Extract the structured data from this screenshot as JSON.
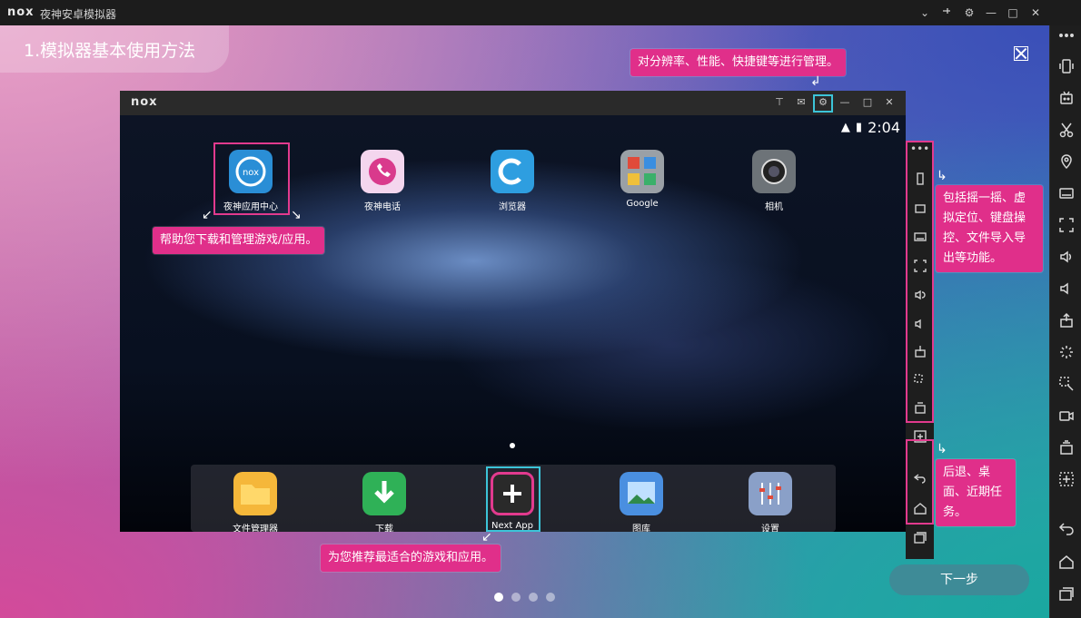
{
  "window": {
    "logo": "nox",
    "title": "夜神安卓模拟器"
  },
  "guide": {
    "heading": "1.模拟器基本使用方法",
    "callouts": {
      "settings": "对分辨率、性能、快捷键等进行管理。",
      "app_center": "帮助您下载和管理游戏/应用。",
      "sidebar_tools": "包括摇一摇、虚拟定位、键盘操控、文件导入导出等功能。",
      "nav_keys": "后退、桌面、近期任务。",
      "next_app": "为您推荐最适合的游戏和应用。"
    },
    "next_button": "下一步",
    "pager": {
      "total": 4,
      "active_index": 0
    }
  },
  "emulator": {
    "logo": "nox",
    "time": "2:04",
    "desktop_apps": [
      {
        "label": "夜神应用中心",
        "icon": "nox-app-center-icon",
        "color": "#2a8ed6"
      },
      {
        "label": "夜神电话",
        "icon": "phone-icon",
        "color": "#f4d6ee"
      },
      {
        "label": "浏览器",
        "icon": "browser-icon",
        "color": "#2e9ee0"
      },
      {
        "label": "Google",
        "icon": "google-folder-icon",
        "color": "#9aa0a6"
      },
      {
        "label": "相机",
        "icon": "camera-icon",
        "color": "#6d7378"
      }
    ],
    "dock_apps": [
      {
        "label": "文件管理器",
        "icon": "folder-icon",
        "color": "#f5b73a"
      },
      {
        "label": "下载",
        "icon": "download-icon",
        "color": "#2fb157"
      },
      {
        "label": "Next App",
        "icon": "next-app-icon",
        "color": "#2a2a2a"
      },
      {
        "label": "图库",
        "icon": "gallery-icon",
        "color": "#4a8fe0"
      },
      {
        "label": "设置",
        "icon": "settings-icon",
        "color": "#8aa0c8"
      }
    ]
  }
}
